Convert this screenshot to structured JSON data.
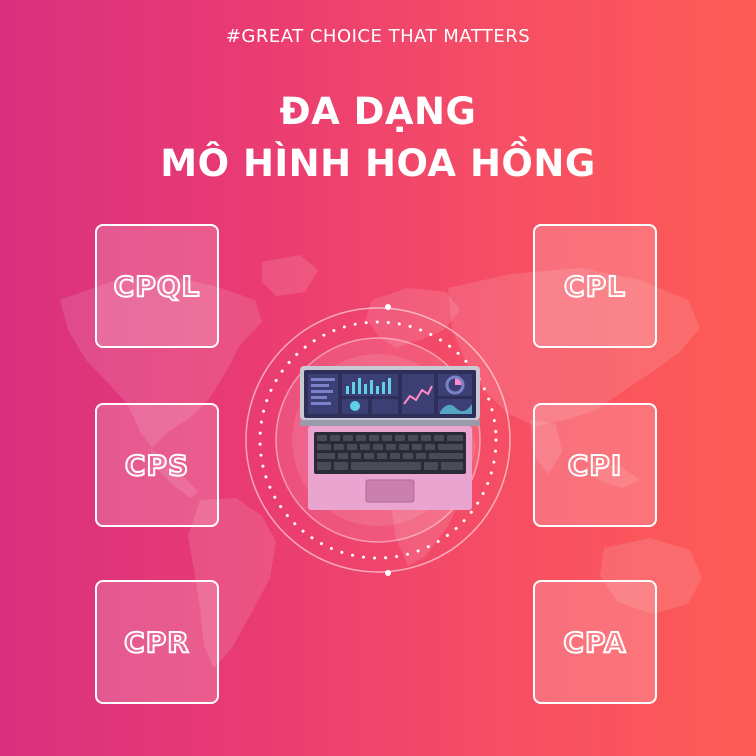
{
  "header": {
    "tagline": "#GREAT CHOICE THAT MATTERS",
    "headline_line1": "ĐA DẠNG",
    "headline_line2": "MÔ HÌNH HOA HỒNG"
  },
  "models": {
    "left": [
      {
        "label": "CPQL"
      },
      {
        "label": "CPS"
      },
      {
        "label": "CPR"
      }
    ],
    "right": [
      {
        "label": "CPL"
      },
      {
        "label": "CPI"
      },
      {
        "label": "CPA"
      }
    ]
  },
  "colors": {
    "gradient_left": "#d8307f",
    "gradient_right": "#fd5c55",
    "card_border": "#ffffff",
    "laptop_body": "#e9a4cf",
    "laptop_screen": "#2d2f5a"
  },
  "icons": {
    "center": "laptop-dashboard-icon",
    "background": "world-map"
  }
}
